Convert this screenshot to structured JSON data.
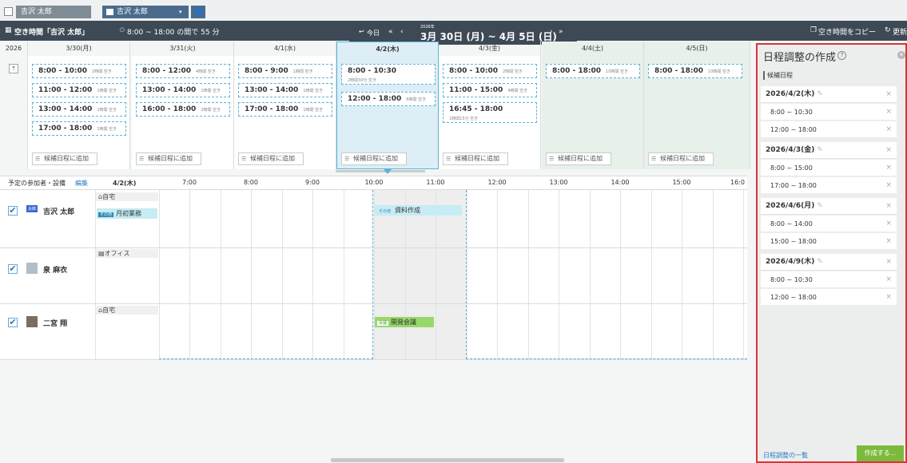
{
  "top_tabs": [
    "吉沢 太郎",
    "吉沢 太郎"
  ],
  "header": {
    "title": "空き時間「吉沢 太郎」",
    "summary": "8:00 ~ 18:00 の間で 55 分",
    "today": "今日",
    "year": "2026年",
    "range": "3月 30日 (月) ~ 4月 5日 (日)"
  },
  "header_right": {
    "copy": "空き時間をコピー",
    "refresh": "更新"
  },
  "year_label": "2026",
  "days": [
    {
      "label": "3/30(月)",
      "slots": [
        {
          "time": "8:00 - 10:00",
          "note": "2時間 空き"
        },
        {
          "time": "11:00 - 12:00",
          "note": "1時間 空き"
        },
        {
          "time": "13:00 - 14:00",
          "note": "1時間 空き"
        },
        {
          "time": "17:00 - 18:00",
          "note": "1時間 空き"
        }
      ]
    },
    {
      "label": "3/31(火)",
      "slots": [
        {
          "time": "8:00 - 12:00",
          "note": "4時間 空き"
        },
        {
          "time": "13:00 - 14:00",
          "note": "1時間 空き"
        },
        {
          "time": "16:00 - 18:00",
          "note": "2時間 空き"
        }
      ]
    },
    {
      "label": "4/1(水)",
      "slots": [
        {
          "time": "8:00 - 9:00",
          "note": "1時間 空き"
        },
        {
          "time": "13:00 - 14:00",
          "note": "1時間 空き"
        },
        {
          "time": "17:00 - 18:00",
          "note": "1時間 空き"
        }
      ]
    },
    {
      "label": "4/2(木)",
      "slots": [
        {
          "time": "8:00 - 10:30",
          "note": "2時間30分 空き"
        },
        {
          "time": "12:00 - 18:00",
          "note": "6時間 空き"
        }
      ]
    },
    {
      "label": "4/3(金)",
      "slots": [
        {
          "time": "8:00 - 10:00",
          "note": "2時間 空き"
        },
        {
          "time": "11:00 - 15:00",
          "note": "4時間 空き"
        },
        {
          "time": "16:45 - 18:00",
          "note": "1時間15分 空き"
        }
      ]
    },
    {
      "label": "4/4(土)",
      "slots": [
        {
          "time": "8:00 - 18:00",
          "note": "10時間 空き"
        }
      ]
    },
    {
      "label": "4/5(日)",
      "slots": [
        {
          "time": "8:00 - 18:00",
          "note": "10時間 空き"
        }
      ]
    }
  ],
  "add_candidate": "候補日程に追加",
  "timeline": {
    "participants_label": "予定の参加者・設備",
    "edit": "編集",
    "date": "4/2(木)",
    "hours": [
      "7:00",
      "8:00",
      "9:00",
      "10:00",
      "11:00",
      "12:00",
      "13:00",
      "14:00",
      "15:00",
      "16:0"
    ],
    "people": [
      {
        "name": "吉沢 太郎",
        "badge": "太郎",
        "location": "自宅",
        "event_tag": "その他",
        "event": "月初業務"
      },
      {
        "name": "泉 麻衣",
        "location": "オフィス"
      },
      {
        "name": "二宮 翔",
        "location": "自宅"
      }
    ],
    "events": [
      {
        "tag": "その他",
        "title": "資料作成"
      },
      {
        "tag": "会議",
        "title": "開発会議"
      }
    ]
  },
  "panel": {
    "title": "日程調整の作成",
    "sub": "候補日程",
    "groups": [
      {
        "date": "2026/4/2(木)",
        "times": [
          "8:00 ~ 10:30",
          "12:00 ~ 18:00"
        ]
      },
      {
        "date": "2026/4/3(金)",
        "times": [
          "8:00 ~ 15:00",
          "17:00 ~ 18:00"
        ]
      },
      {
        "date": "2026/4/6(月)",
        "times": [
          "8:00 ~ 14:00",
          "15:00 ~ 18:00"
        ]
      },
      {
        "date": "2026/4/9(木)",
        "times": [
          "8:00 ~ 10:30",
          "12:00 ~ 18:00"
        ]
      }
    ],
    "list_link": "日程調整の一覧",
    "create": "作成する..."
  },
  "colors": {
    "accent": "#5bb5d8",
    "header": "#3d4a55",
    "panel_border": "#dd3333",
    "create_btn": "#7cba3b",
    "event_blue": "#c6ecf5",
    "event_green": "#98d86b"
  }
}
